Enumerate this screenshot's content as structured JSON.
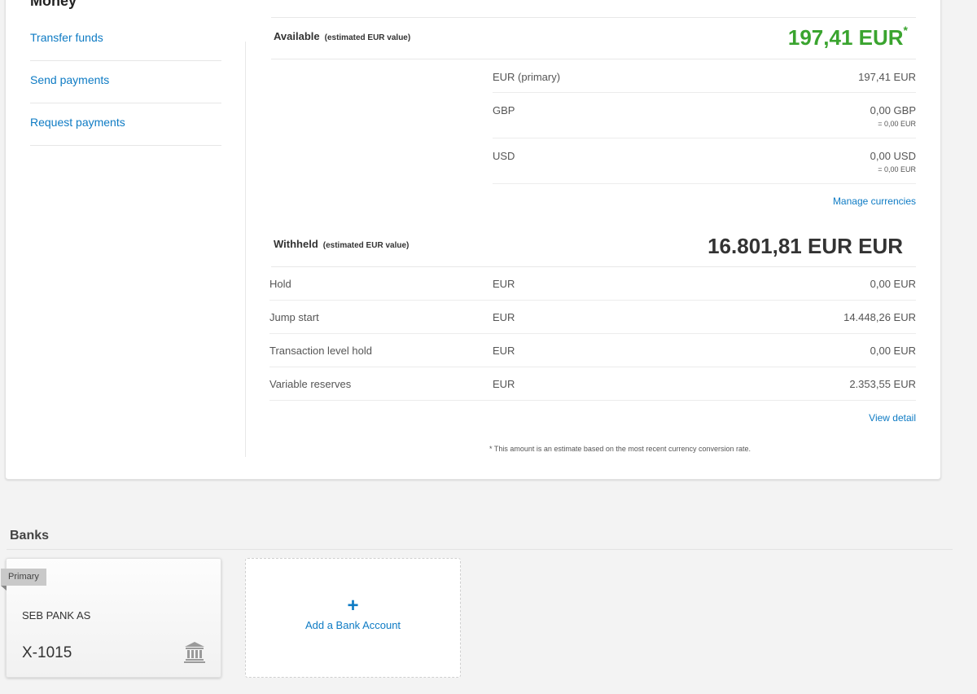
{
  "money": {
    "title": "Money",
    "nav": [
      "Transfer funds",
      "Send payments",
      "Request payments"
    ],
    "available": {
      "label": "Available",
      "note": "(estimated EUR value)",
      "total": "197,41 EUR",
      "total_marker": "*",
      "currencies": [
        {
          "name": "EUR (primary)",
          "value": "197,41 EUR",
          "sub": ""
        },
        {
          "name": "GBP",
          "value": "0,00 GBP",
          "sub": "= 0,00 EUR"
        },
        {
          "name": "USD",
          "value": "0,00 USD",
          "sub": "= 0,00 EUR"
        }
      ],
      "manage_link": "Manage currencies"
    },
    "withheld": {
      "label": "Withheld",
      "note": "(estimated EUR value)",
      "total": "16.801,81 EUR EUR",
      "rows": [
        {
          "label": "Hold",
          "currency": "EUR",
          "value": "0,00 EUR"
        },
        {
          "label": "Jump start",
          "currency": "EUR",
          "value": "14.448,26 EUR"
        },
        {
          "label": "Transaction level hold",
          "currency": "EUR",
          "value": "0,00 EUR"
        },
        {
          "label": "Variable reserves",
          "currency": "EUR",
          "value": "2.353,55 EUR"
        }
      ],
      "detail_link": "View detail"
    },
    "footnote": "* This amount is an estimate based on the most recent currency conversion rate."
  },
  "banks": {
    "title": "Banks",
    "cards": [
      {
        "badge": "Primary",
        "name": "SEB PANK AS",
        "account": "X-1015",
        "icon": "bank-icon"
      }
    ],
    "add": {
      "plus": "+",
      "label": "Add a Bank Account"
    }
  },
  "colors": {
    "link": "#0e7bc4",
    "available_total": "#3aa42f"
  }
}
